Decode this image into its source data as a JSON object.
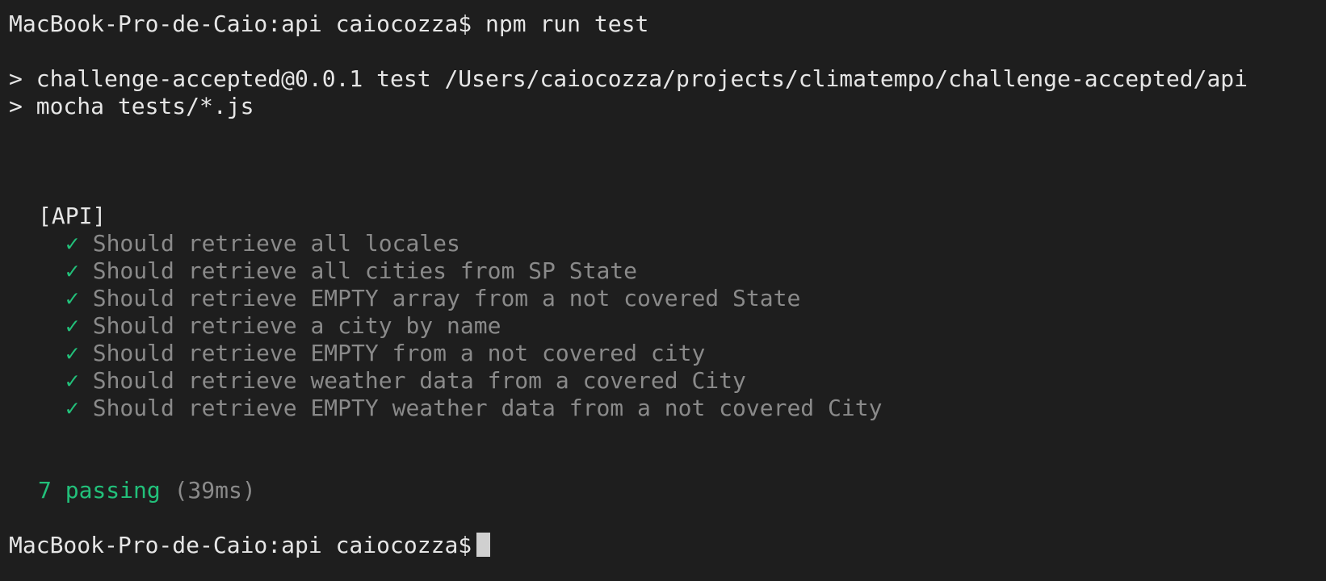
{
  "terminal": {
    "prompt": "MacBook-Pro-de-Caio:api caiocozza$",
    "command": "npm run test",
    "npm_output": [
      "> challenge-accepted@0.0.1 test /Users/caiocozza/projects/climatempo/challenge-accepted/api",
      "> mocha tests/*.js"
    ],
    "suite": "[API]",
    "check_glyph": "✓",
    "tests": [
      "Should retrieve all locales",
      "Should retrieve all cities from SP State",
      "Should retrieve EMPTY array from a not covered State",
      "Should retrieve a city by name",
      "Should retrieve EMPTY from a not covered city",
      "Should retrieve weather data from a covered City",
      "Should retrieve EMPTY weather data from a not covered City"
    ],
    "summary": {
      "passing": "7 passing",
      "duration": "(39ms)"
    },
    "final_prompt": "MacBook-Pro-de-Caio:api caiocozza$"
  },
  "colors": {
    "background": "#1e1e1e",
    "text": "#e6e6e6",
    "pass_green": "#22c07a",
    "dim_gray": "#8a8a8a"
  }
}
